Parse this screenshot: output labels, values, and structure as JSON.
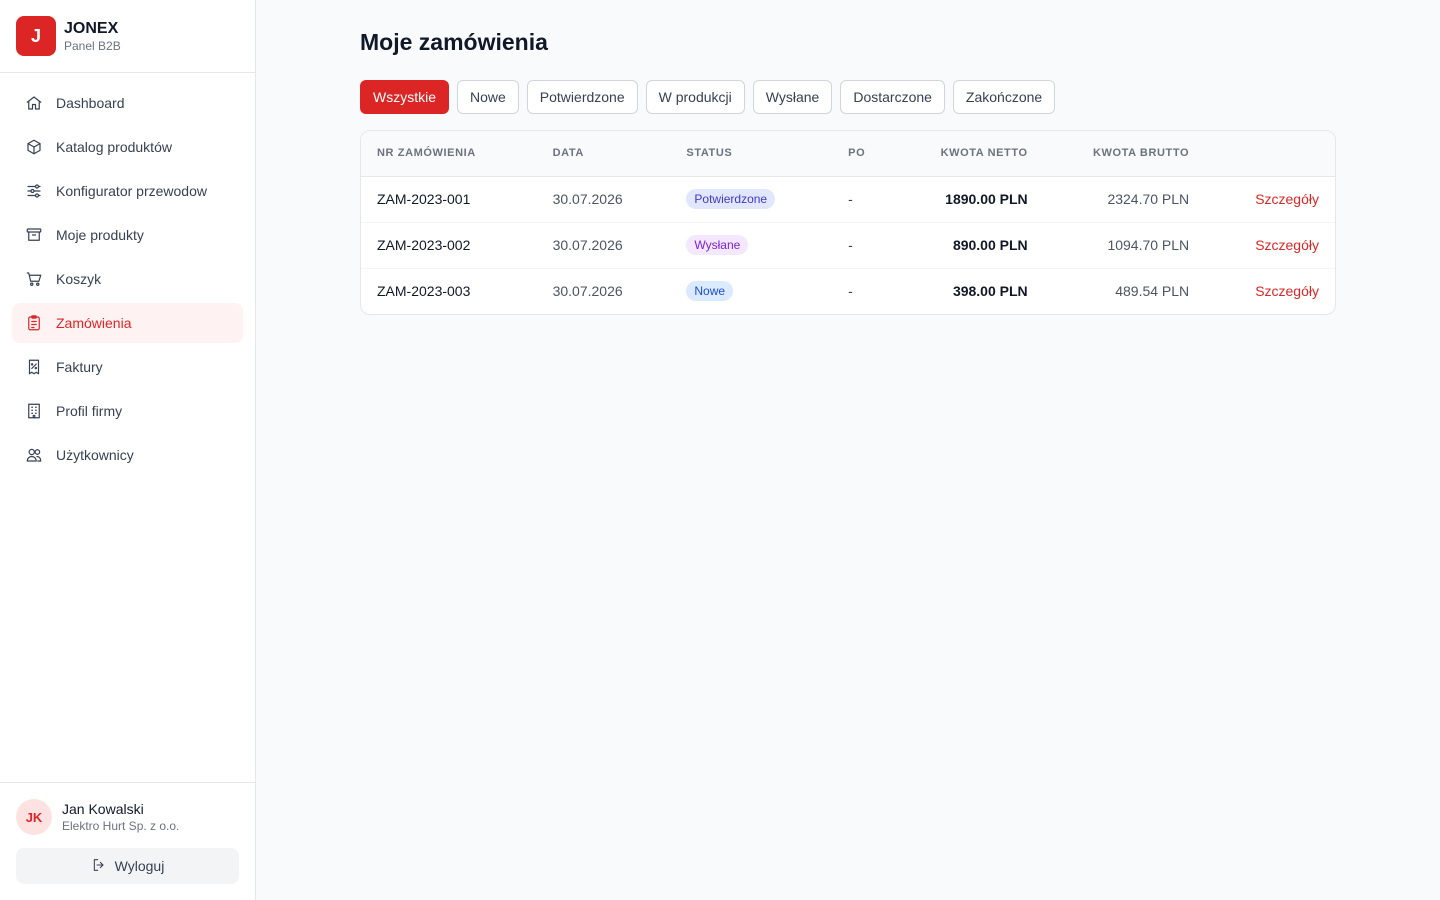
{
  "brand": {
    "logo_letter": "J",
    "name": "JONEX",
    "subtitle": "Panel B2B"
  },
  "sidebar": {
    "items": [
      {
        "label": "Dashboard",
        "icon": "home-icon",
        "active": false
      },
      {
        "label": "Katalog produktów",
        "icon": "box-icon",
        "active": false
      },
      {
        "label": "Konfigurator przewodow",
        "icon": "sliders-icon",
        "active": false
      },
      {
        "label": "Moje produkty",
        "icon": "archive-icon",
        "active": false
      },
      {
        "label": "Koszyk",
        "icon": "cart-icon",
        "active": false
      },
      {
        "label": "Zamówienia",
        "icon": "clipboard-icon",
        "active": true
      },
      {
        "label": "Faktury",
        "icon": "invoice-icon",
        "active": false
      },
      {
        "label": "Profil firmy",
        "icon": "building-icon",
        "active": false
      },
      {
        "label": "Użytkownicy",
        "icon": "users-icon",
        "active": false
      }
    ]
  },
  "user": {
    "initials": "JK",
    "name": "Jan Kowalski",
    "company": "Elektro Hurt Sp. z o.o.",
    "logout_label": "Wyloguj"
  },
  "page": {
    "title": "Moje zamówienia"
  },
  "filters": [
    {
      "label": "Wszystkie",
      "active": true
    },
    {
      "label": "Nowe",
      "active": false
    },
    {
      "label": "Potwierdzone",
      "active": false
    },
    {
      "label": "W produkcji",
      "active": false
    },
    {
      "label": "Wysłane",
      "active": false
    },
    {
      "label": "Dostarczone",
      "active": false
    },
    {
      "label": "Zakończone",
      "active": false
    }
  ],
  "table": {
    "headers": {
      "order_no": "NR ZAMÓWIENIA",
      "date": "DATA",
      "status": "STATUS",
      "po": "PO",
      "netto": "KWOTA NETTO",
      "brutto": "KWOTA BRUTTO"
    },
    "rows": [
      {
        "order_no": "ZAM-2023-001",
        "date": "30.07.2026",
        "status": "Potwierdzone",
        "po": "-",
        "netto": "1890.00 PLN",
        "brutto": "2324.70 PLN",
        "action": "Szczegóły"
      },
      {
        "order_no": "ZAM-2023-002",
        "date": "30.07.2026",
        "status": "Wysłane",
        "po": "-",
        "netto": "890.00 PLN",
        "brutto": "1094.70 PLN",
        "action": "Szczegóły"
      },
      {
        "order_no": "ZAM-2023-003",
        "date": "30.07.2026",
        "status": "Nowe",
        "po": "-",
        "netto": "398.00 PLN",
        "brutto": "489.54 PLN",
        "action": "Szczegóły"
      }
    ]
  },
  "colors": {
    "accent": "#dc2626",
    "status": {
      "Potwierdzone": {
        "bg": "#e0e7ff",
        "fg": "#4338ca"
      },
      "Wysłane": {
        "bg": "#f3e8ff",
        "fg": "#7e22ce"
      },
      "Nowe": {
        "bg": "#dbeafe",
        "fg": "#1d4ed8"
      }
    }
  }
}
